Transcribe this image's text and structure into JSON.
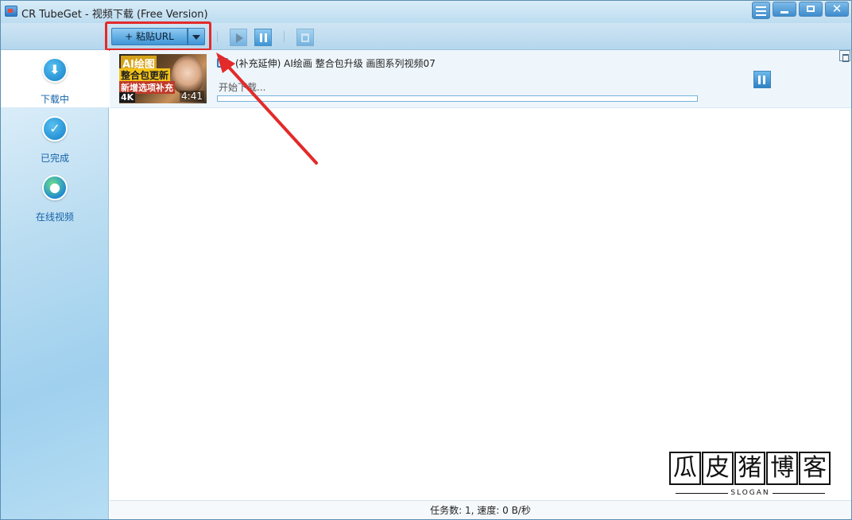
{
  "window": {
    "title": "CR TubeGet - 视频下载 (Free Version)"
  },
  "toolbar": {
    "paste_label": "+ 粘贴URL"
  },
  "sidebar": {
    "items": [
      {
        "label": "下载中",
        "icon": "download-icon",
        "active": true
      },
      {
        "label": "已完成",
        "icon": "checkmark-icon",
        "active": false
      },
      {
        "label": "在线视频",
        "icon": "globe-icon",
        "active": false
      }
    ]
  },
  "task": {
    "title": "(补充延伸) AI绘画 整合包升级 画图系列视频07",
    "status": "开始下载...",
    "duration": "4:41",
    "progress_percent": 0,
    "thumbnail_text": {
      "line1": "AI绘图",
      "line2": "整合包更新",
      "line3": "新增选项补充",
      "badge": "4K"
    }
  },
  "watermark": {
    "chars": [
      "瓜",
      "皮",
      "猪",
      "博",
      "客"
    ],
    "slogan": "SLOGAN"
  },
  "statusbar": {
    "text": "任务数: 1, 速度: 0 B/秒"
  },
  "colors": {
    "accent": "#3f95d6",
    "highlight": "#e32a2a",
    "nav_text": "#1563a8"
  }
}
